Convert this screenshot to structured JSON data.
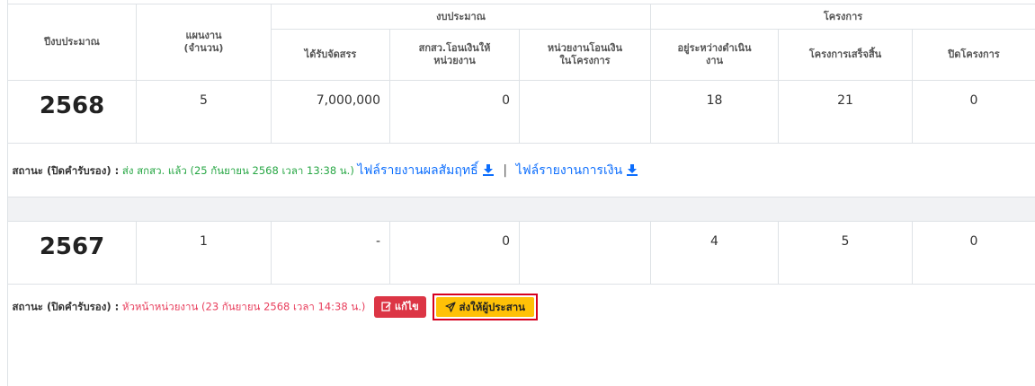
{
  "headers": {
    "year": "ปีงบประมาณ",
    "plan_line1": "แผนงาน",
    "plan_line2": "(จำนวน)",
    "budget_group": "งบประมาณ",
    "project_group": "โครงการ",
    "allocated": "ได้รับจัดสรร",
    "transfer_line1": "สกสว.โอนเงินให้",
    "transfer_line2": "หน่วยงาน",
    "unit_transfer_line1": "หน่วยงานโอนเงิน",
    "unit_transfer_line2": "ในโครงการ",
    "ongoing_line1": "อยู่ระหว่างดำเนิน",
    "ongoing_line2": "งาน",
    "completed": "โครงการเสร็จสิ้น",
    "closed": "ปิดโครงการ"
  },
  "rows": [
    {
      "year": "2568",
      "plans": "5",
      "allocated": "7,000,000",
      "transferred": "0",
      "unit_transferred": "",
      "ongoing": "18",
      "completed": "21",
      "closed": "0",
      "status_label": "สถานะ (ปิดคำรับรอง) :",
      "status_text": "ส่ง สกสว. แล้ว (25 กันยายน 2568 เวลา 13:38 น.)",
      "link_result": "ไฟล์รายงานผลสัมฤทธิ์",
      "separator": "|",
      "link_finance": "ไฟล์รายงานการเงิน"
    },
    {
      "year": "2567",
      "plans": "1",
      "allocated": "-",
      "transferred": "0",
      "unit_transferred": "",
      "ongoing": "4",
      "completed": "5",
      "closed": "0",
      "status_label": "สถานะ (ปิดคำรับรอง) :",
      "status_text": "หัวหน้าหน่วยงาน (23 กันยายน 2568 เวลา 14:38 น.)",
      "edit_label": "แก้ไข",
      "send_label": "ส่งให้ผู้ประสาน"
    }
  ],
  "colors": {
    "success_text": "#28a745",
    "danger_text": "#e83e5c",
    "link": "#0d6efd",
    "edit_button": "#dc3545",
    "send_button": "#ffc107",
    "highlight_outline": "#d7001e"
  },
  "icons": {
    "download": "download-icon",
    "edit": "edit-icon",
    "send": "paper-plane-icon"
  }
}
